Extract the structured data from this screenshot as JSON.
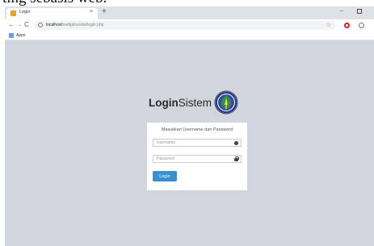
{
  "caption": "ting sebasis web.",
  "browser": {
    "tab_title": "Login",
    "tab_close": "×",
    "new_tab": "+",
    "window_minimize": "–",
    "nav_back": "←",
    "nav_forward": "→",
    "nav_reload": "C",
    "url_host": "localhost",
    "url_path": "/webjaitusalia/login.php",
    "star": "☆",
    "bookmarks_apps": "Apps"
  },
  "login": {
    "brand_bold": "Login",
    "brand_rest": "Sistem",
    "heading": "Masukkan Username dan Password",
    "username_placeholder": "Username",
    "password_placeholder": "Password",
    "button_label": "Login"
  },
  "colors": {
    "page_background": "#d1d5de",
    "button": "#3a8fd0",
    "logo_primary": "#2a3a8c"
  },
  "icons": {
    "user": "user-icon",
    "password": "lock-icon",
    "logo": "university-seal-icon"
  }
}
